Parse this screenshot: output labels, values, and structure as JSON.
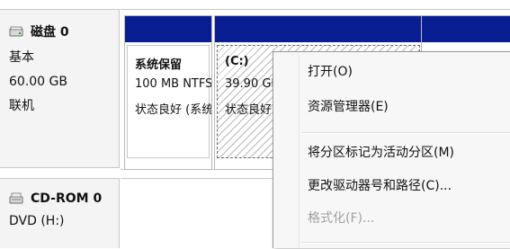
{
  "disks": [
    {
      "title": "磁盘 0",
      "icon": "hard-disk-icon",
      "type": "基本",
      "size": "60.00 GB",
      "status": "联机"
    },
    {
      "title": "CD-ROM 0",
      "icon": "cd-rom-icon",
      "type": "DVD (H:)"
    }
  ],
  "partitions": [
    {
      "name": "系统保留",
      "size": "100 MB NTFS",
      "status": "状态良好 (系统"
    },
    {
      "name": "(C:)",
      "size": "39.90 GB",
      "status": "状态良好"
    }
  ],
  "context_menu": {
    "items": [
      {
        "label": "打开(O)",
        "enabled": true
      },
      {
        "label": "资源管理器(E)",
        "enabled": true
      },
      {
        "label": "将分区标记为活动分区(M)",
        "enabled": true
      },
      {
        "label": "更改驱动器号和路径(C)...",
        "enabled": true
      },
      {
        "label": "格式化(F)...",
        "enabled": false
      }
    ]
  },
  "colors": {
    "partition_header": "#0a1e93",
    "menu_background": "#f7f7f7",
    "disabled_text": "#a0a0a0"
  }
}
